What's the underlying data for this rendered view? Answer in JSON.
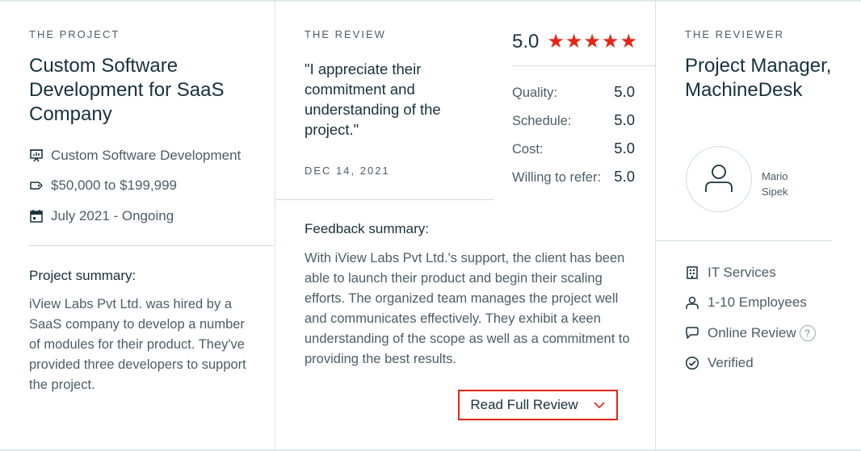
{
  "project": {
    "eyebrow": "THE PROJECT",
    "title": "Custom Software Development for SaaS Company",
    "service": "Custom Software Development",
    "budget": "$50,000 to $199,999",
    "timeline": "July 2021 - Ongoing",
    "summary_label": "Project summary:",
    "summary": "iView Labs Pvt Ltd. was hired by a SaaS company to develop a number of modules for their product. They've provided three developers to support the project.",
    "icons": [
      "presentation-icon",
      "price-tag-icon",
      "calendar-icon"
    ]
  },
  "review": {
    "eyebrow": "THE REVIEW",
    "quote": "\"I appreciate their commitment and understanding of the project.\"",
    "date": "DEC 14, 2021",
    "overall": "5.0",
    "star_count": 5,
    "scores": [
      {
        "label": "Quality:",
        "value": "5.0"
      },
      {
        "label": "Schedule:",
        "value": "5.0"
      },
      {
        "label": "Cost:",
        "value": "5.0"
      },
      {
        "label": "Willing to refer:",
        "value": "5.0"
      }
    ],
    "feedback_label": "Feedback summary:",
    "feedback": "With iView Labs Pvt Ltd.'s support, the client has been able to launch their product and begin their scaling efforts. The organized team manages the project well and communicates effectively. They exhibit a keen understanding of the scope as well as a commitment to providing the best results.",
    "button_label": "Read Full Review"
  },
  "reviewer": {
    "eyebrow": "THE REVIEWER",
    "title": "Project Manager, MachineDesk",
    "name": "Mario Sipek",
    "industry": "IT Services",
    "size": "1-10 Employees",
    "review_type": "Online Review",
    "help_glyph": "?",
    "verified": "Verified"
  },
  "colors": {
    "accent": "#e62415",
    "text_dark": "#17313b",
    "text_muted": "#4b5d66",
    "divider": "#cfdde2"
  }
}
